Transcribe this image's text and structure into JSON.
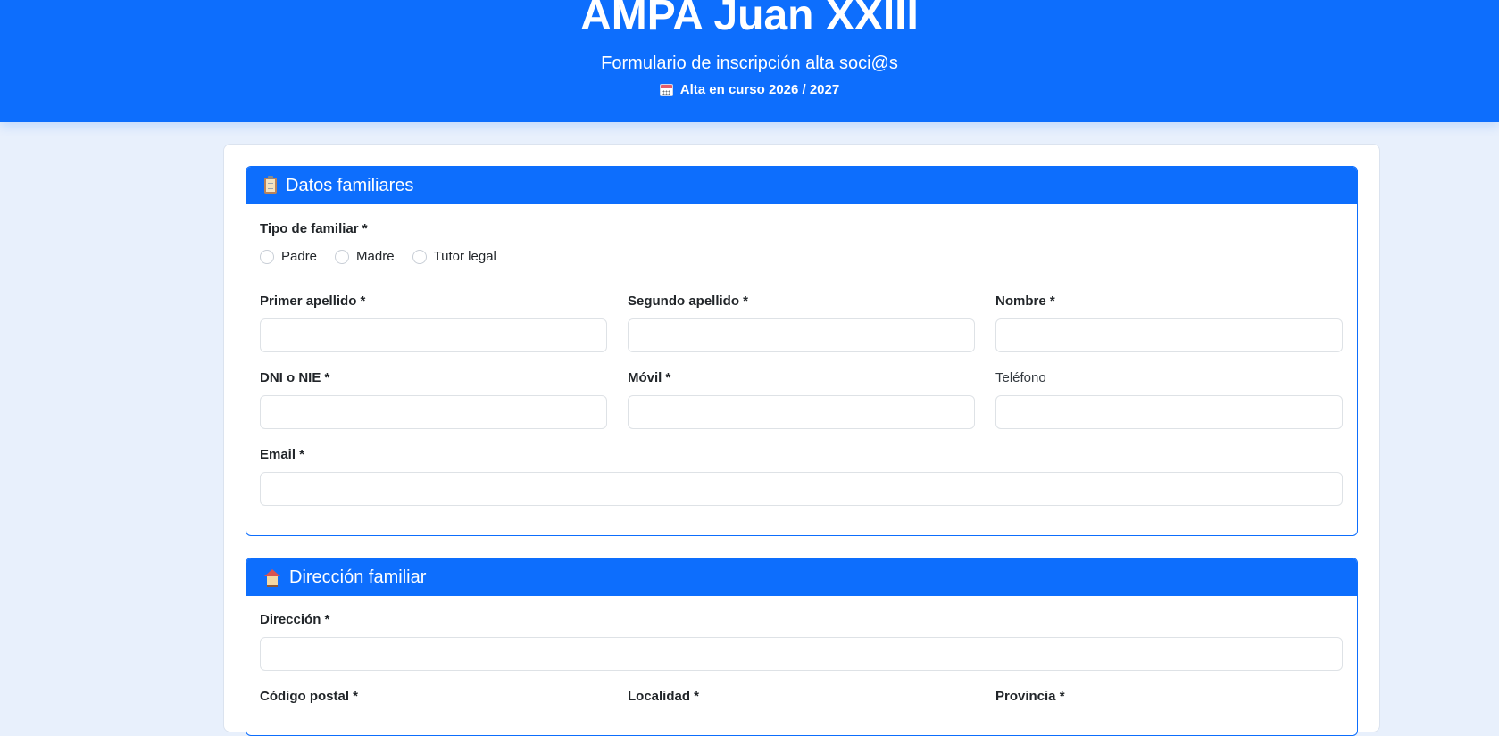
{
  "header": {
    "title": "AMPA Juan XXIII",
    "subtitle": "Formulario de inscripción alta soci@s",
    "badge": "Alta en curso 2026 / 2027",
    "badge_icon": "calendar-icon"
  },
  "colors": {
    "primary": "#0d6efd",
    "page_background": "#e8f0fc"
  },
  "sections": {
    "family": {
      "title": "Datos familiares",
      "icon": "clipboard-icon",
      "tipo_label": "Tipo de familiar *",
      "tipo_options": [
        "Padre",
        "Madre",
        "Tutor legal"
      ],
      "tipo_selected": "",
      "primer_apellido_label": "Primer apellido *",
      "primer_apellido_value": "",
      "segundo_apellido_label": "Segundo apellido *",
      "segundo_apellido_value": "",
      "nombre_label": "Nombre *",
      "nombre_value": "",
      "dni_label": "DNI o NIE *",
      "dni_value": "",
      "movil_label": "Móvil *",
      "movil_value": "",
      "telefono_label": "Teléfono",
      "telefono_value": "",
      "email_label": "Email *",
      "email_value": ""
    },
    "address": {
      "title": "Dirección familiar",
      "icon": "house-icon",
      "direccion_label": "Dirección *",
      "direccion_value": "",
      "codigo_postal_label": "Código postal *",
      "localidad_label": "Localidad *",
      "provincia_label": "Provincia *"
    }
  }
}
